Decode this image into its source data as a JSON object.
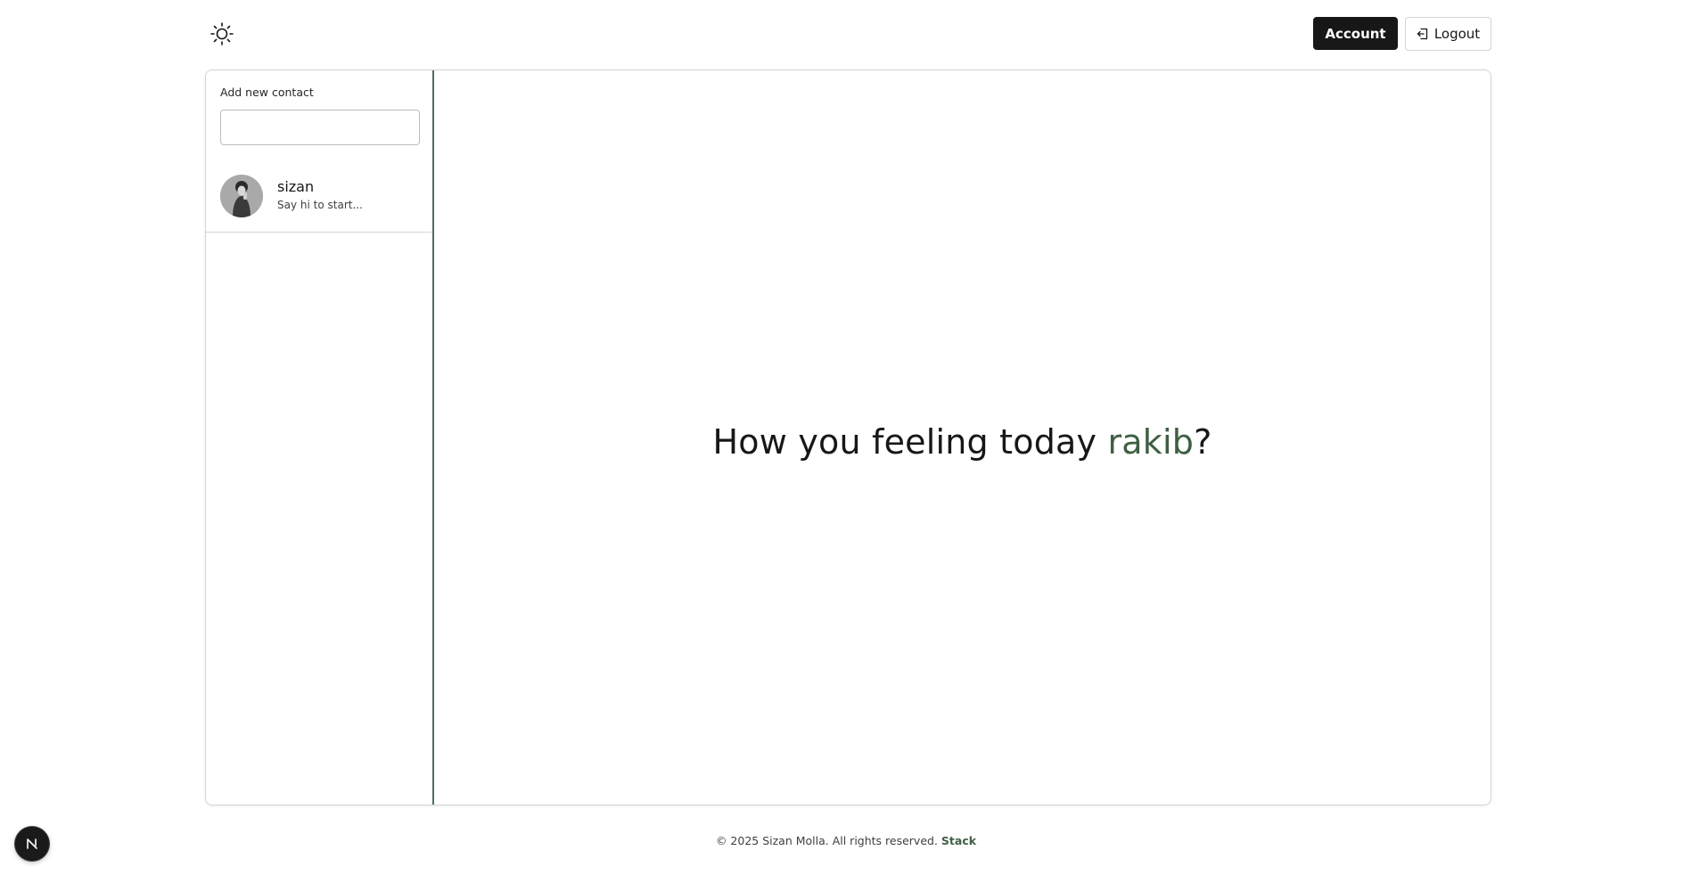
{
  "header": {
    "theme_toggle_icon": "sun-icon",
    "account_label": "Account",
    "logout_label": "Logout",
    "logout_icon": "logout-icon"
  },
  "sidebar": {
    "add_contact_label": "Add new contact",
    "add_contact_value": "",
    "contacts": [
      {
        "name": "sizan",
        "preview": "Say hi to start..."
      }
    ]
  },
  "main": {
    "greeting_prefix": "How you feeling today ",
    "greeting_name": "rakib",
    "greeting_suffix": "?"
  },
  "footer": {
    "copyright": "© 2025 Sizan Molla. All rights reserved.",
    "brand": "Stack"
  },
  "colors": {
    "accent_green": "#3f5e42",
    "primary_dark": "#171717",
    "sidebar_divider": "#4b6e6a"
  }
}
